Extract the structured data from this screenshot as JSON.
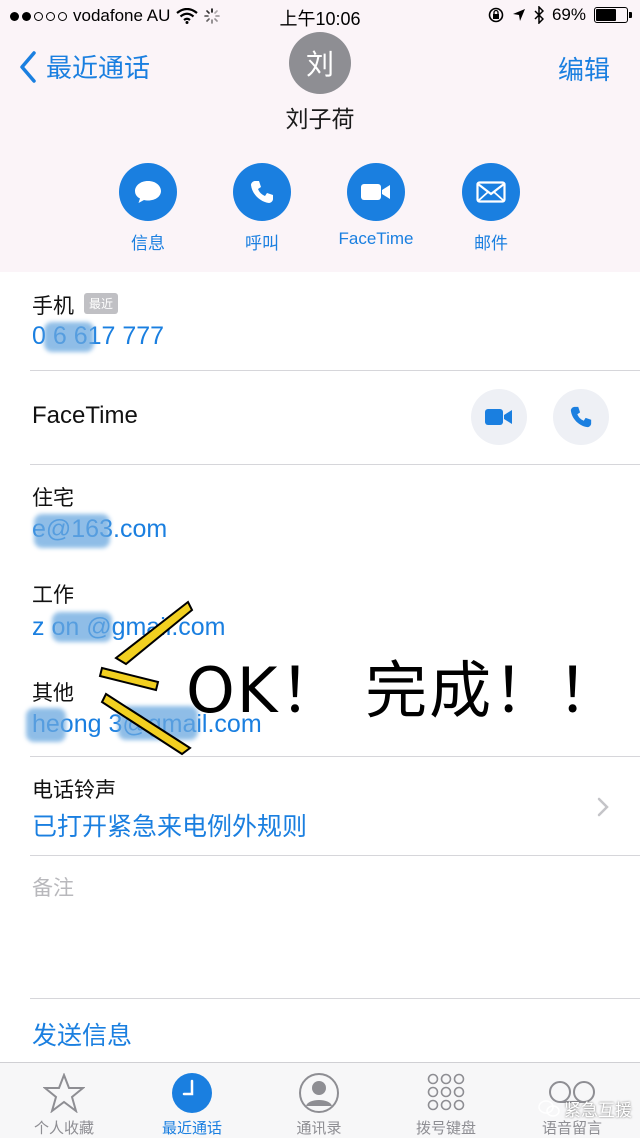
{
  "status_bar": {
    "carrier": "vodafone AU",
    "time": "上午10:06",
    "battery": "69%",
    "battery_level": 0.69
  },
  "nav": {
    "back_label": "最近通话",
    "edit_label": "编辑",
    "avatar_initial": "刘",
    "contact_name": "刘子荷"
  },
  "actions": [
    {
      "label": "信息",
      "icon": "message-icon"
    },
    {
      "label": "呼叫",
      "icon": "phone-icon"
    },
    {
      "label": "FaceTime",
      "icon": "video-icon"
    },
    {
      "label": "邮件",
      "icon": "mail-icon"
    }
  ],
  "phone": {
    "label": "手机",
    "badge": "最近",
    "number": "0      6 617 777"
  },
  "facetime": {
    "label": "FaceTime"
  },
  "emails": [
    {
      "label": "住宅",
      "value": "         e@163.com"
    },
    {
      "label": "工作",
      "value": "z   on     @gmail.com"
    },
    {
      "label": "其他",
      "value": "   heong       3@gmail.com"
    }
  ],
  "annotation": {
    "text": "OK！ 完成！！",
    "accent": "#f2d020"
  },
  "ringtone": {
    "label": "电话铃声",
    "value": "已打开紧急来电例外规则"
  },
  "notes_placeholder": "备注",
  "send_message": "发送信息",
  "tabs": [
    {
      "label": "个人收藏",
      "icon": "star-icon",
      "active": false
    },
    {
      "label": "最近通话",
      "icon": "clock-icon",
      "active": true
    },
    {
      "label": "通讯录",
      "icon": "person-icon",
      "active": false
    },
    {
      "label": "拨号键盘",
      "icon": "keypad-icon",
      "active": false
    },
    {
      "label": "语音留言",
      "icon": "voicemail-icon",
      "active": false
    }
  ],
  "watermark": "紧急互援",
  "colors": {
    "accent": "#1a7fe0",
    "header_bg": "#fbf4f8"
  }
}
